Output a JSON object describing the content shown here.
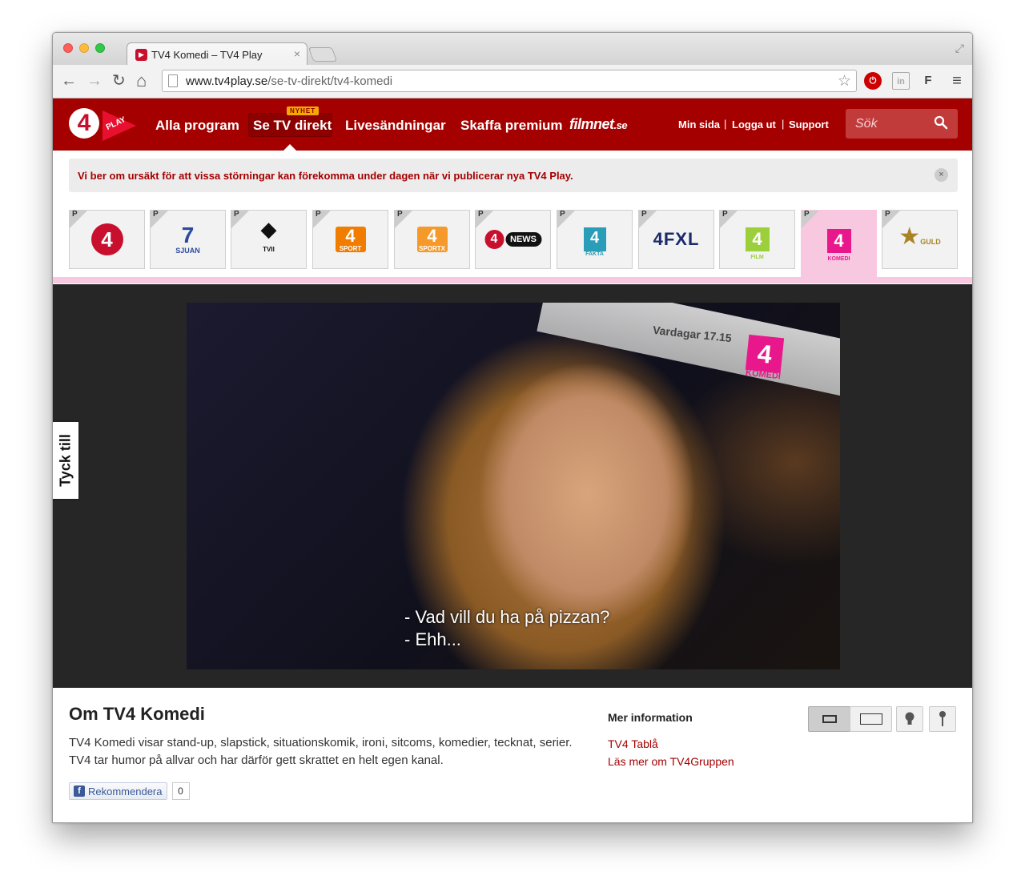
{
  "browser": {
    "tab_title": "TV4 Komedi – TV4 Play",
    "favicon_text": "▶",
    "tab_close": "×",
    "url_domain": "www.tv4play.se",
    "url_path": "/se-tv-direkt/tv4-komedi",
    "ext_stop": "⏻",
    "ext_in": "in",
    "ext_f": "F",
    "menu_glyph": "≡",
    "back": "←",
    "forward": "→",
    "reload": "↻",
    "home": "⌂",
    "star": "☆",
    "resize": "⤢"
  },
  "header": {
    "logo_number": "4",
    "logo_play": "PLAY",
    "nav": [
      "Alla program",
      "Se TV direkt",
      "Livesändningar",
      "Skaffa premium"
    ],
    "nyhet_badge": "NYHET",
    "filmnet": "filmnet",
    "filmnet_suffix": ".se",
    "user_links": [
      "Min sida",
      "Logga ut",
      "Support"
    ],
    "separator": "|",
    "search_placeholder": "Sök",
    "search_icon_glyph": "🔍"
  },
  "notice": {
    "text": "Vi ber om ursäkt för att vissa störningar kan förekomma under dagen när vi publicerar nya TV4 Play.",
    "close_glyph": "×"
  },
  "channels": {
    "premium_mark": "P",
    "active_channel": "TV4 Komedi",
    "items": [
      {
        "main": "4",
        "sub": ""
      },
      {
        "main": "7",
        "sub": "SJUAN"
      },
      {
        "main": "◆",
        "sub": "TVII"
      },
      {
        "main": "4",
        "sub": "SPORT"
      },
      {
        "main": "4",
        "sub": "SPORTX"
      },
      {
        "main": "4",
        "sub": "NEWS"
      },
      {
        "main": "4",
        "sub": "FAKTA"
      },
      {
        "main": "4FXL",
        "sub": ""
      },
      {
        "main": "4",
        "sub": "FILM"
      },
      {
        "main": "4",
        "sub": "KOMEDI"
      },
      {
        "main": "★",
        "sub": "GULD"
      }
    ]
  },
  "player": {
    "overlay_time": "Vardagar 17.15",
    "overlay_logo": "4",
    "overlay_channel": "KOMEDI",
    "subtitle_line1": "- Vad vill du ha på pizzan?",
    "subtitle_line2": "- Ehh...",
    "feedback_tab": "Tyck till"
  },
  "info": {
    "title": "Om TV4 Komedi",
    "description": "TV4 Komedi visar stand-up, slapstick, situationskomik, ironi, sitcoms, komedier, tecknat, serier. TV4 tar humor på allvar och har därför gett skrattet en helt egen kanal.",
    "fb_icon": "f",
    "fb_label": "Rekommendera",
    "fb_count": "0",
    "more_heading": "Mer information",
    "more_links": [
      "TV4 Tablå",
      "Läs mer om TV4Gruppen"
    ]
  }
}
